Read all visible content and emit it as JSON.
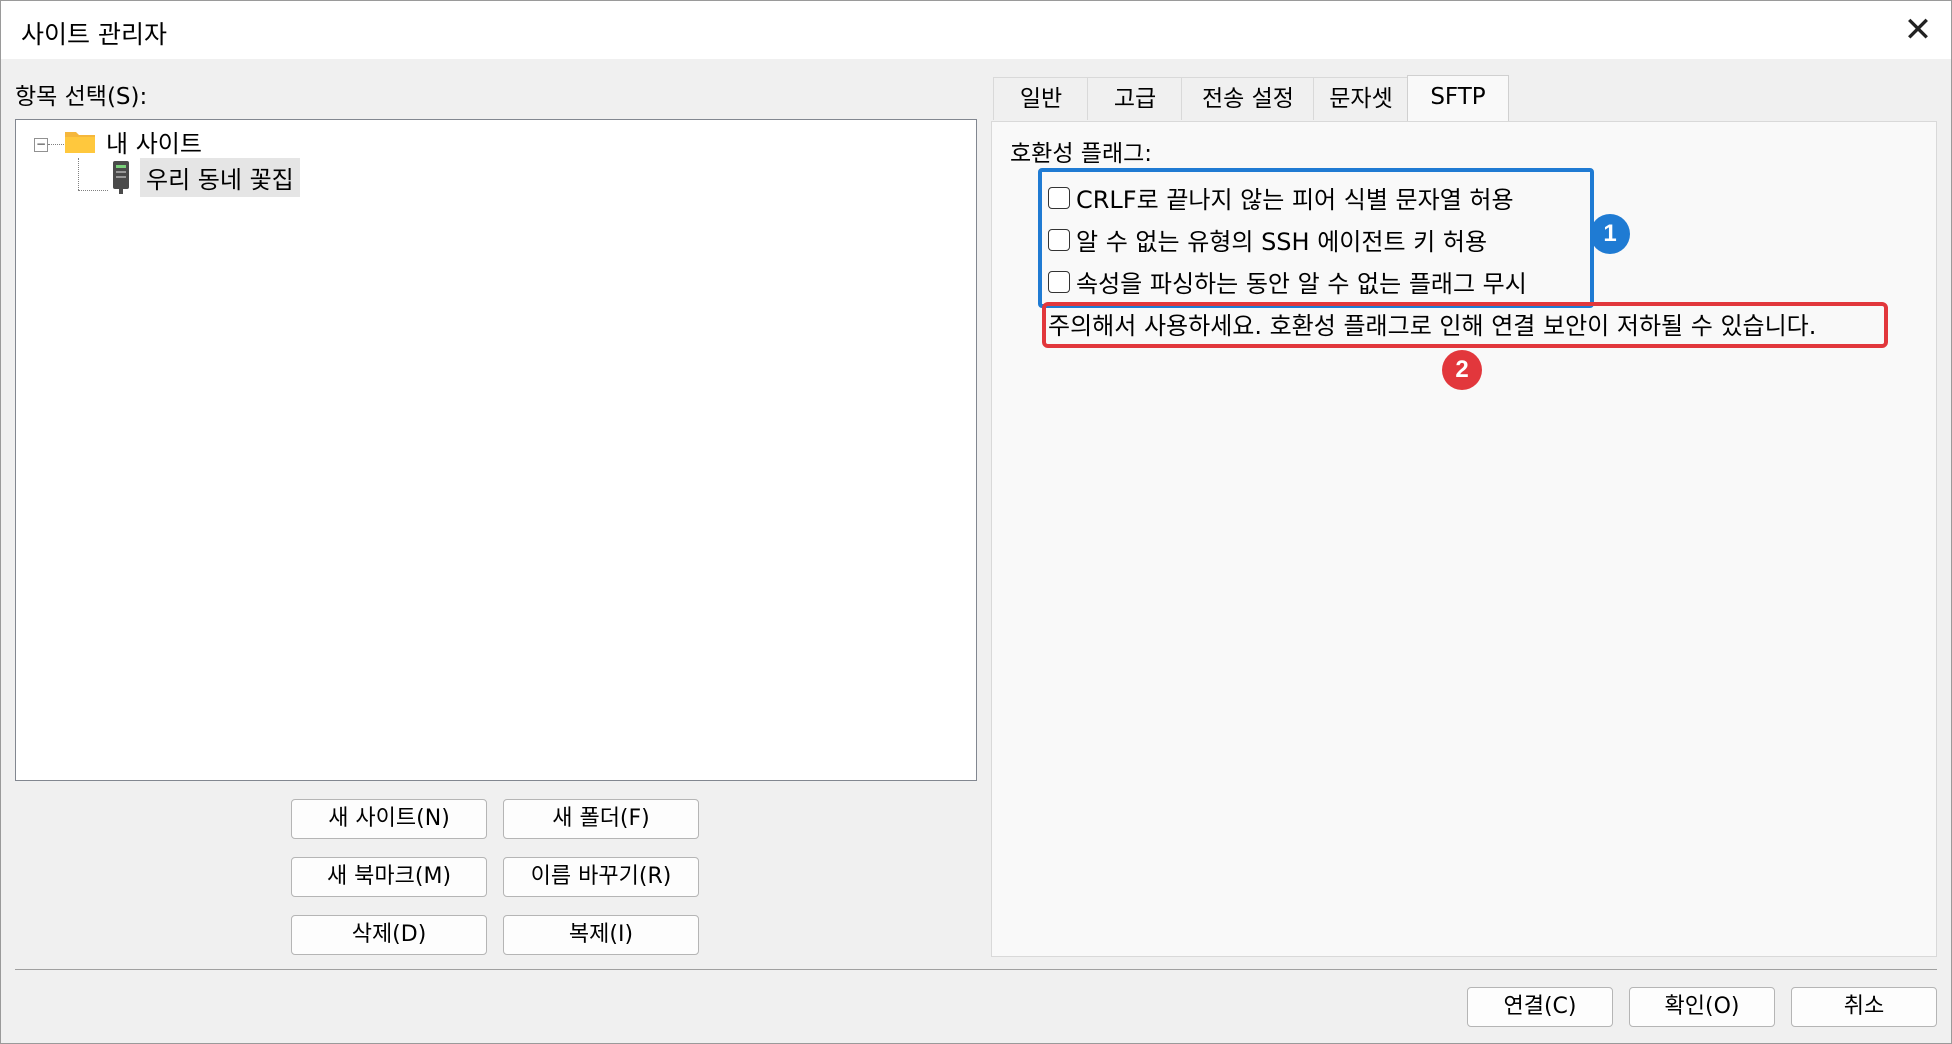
{
  "window": {
    "title": "사이트 관리자",
    "close_label": "✕"
  },
  "left": {
    "select_label": "항목 선택(S):",
    "tree": {
      "root_label": "내 사이트",
      "child_label": "우리 동네 꽃집"
    },
    "buttons": {
      "new_site": "새 사이트(N)",
      "new_folder": "새 폴더(F)",
      "new_bookmark": "새 북마크(M)",
      "rename": "이름 바꾸기(R)",
      "delete": "삭제(D)",
      "duplicate": "복제(I)"
    }
  },
  "tabs": [
    "일반",
    "고급",
    "전송 설정",
    "문자셋",
    "SFTP"
  ],
  "active_tab": "SFTP",
  "sftp": {
    "compat_label": "호환성 플래그:",
    "options": [
      {
        "label": "CRLF로 끝나지 않는 피어 식별 문자열 허용",
        "checked": false
      },
      {
        "label": "알 수 없는 유형의 SSH 에이전트 키 허용",
        "checked": false
      },
      {
        "label": "속성을 파싱하는 동안 알 수 없는 플래그 무시",
        "checked": false
      }
    ],
    "warning": "주의해서 사용하세요. 호환성 플래그로 인해 연결 보안이 저하될 수 있습니다."
  },
  "annotations": {
    "badge1": "1",
    "badge2": "2",
    "blue": "#1f7bd3",
    "red": "#e2373c"
  },
  "footer": {
    "connect": "연결(C)",
    "ok": "확인(O)",
    "cancel": "취소"
  }
}
